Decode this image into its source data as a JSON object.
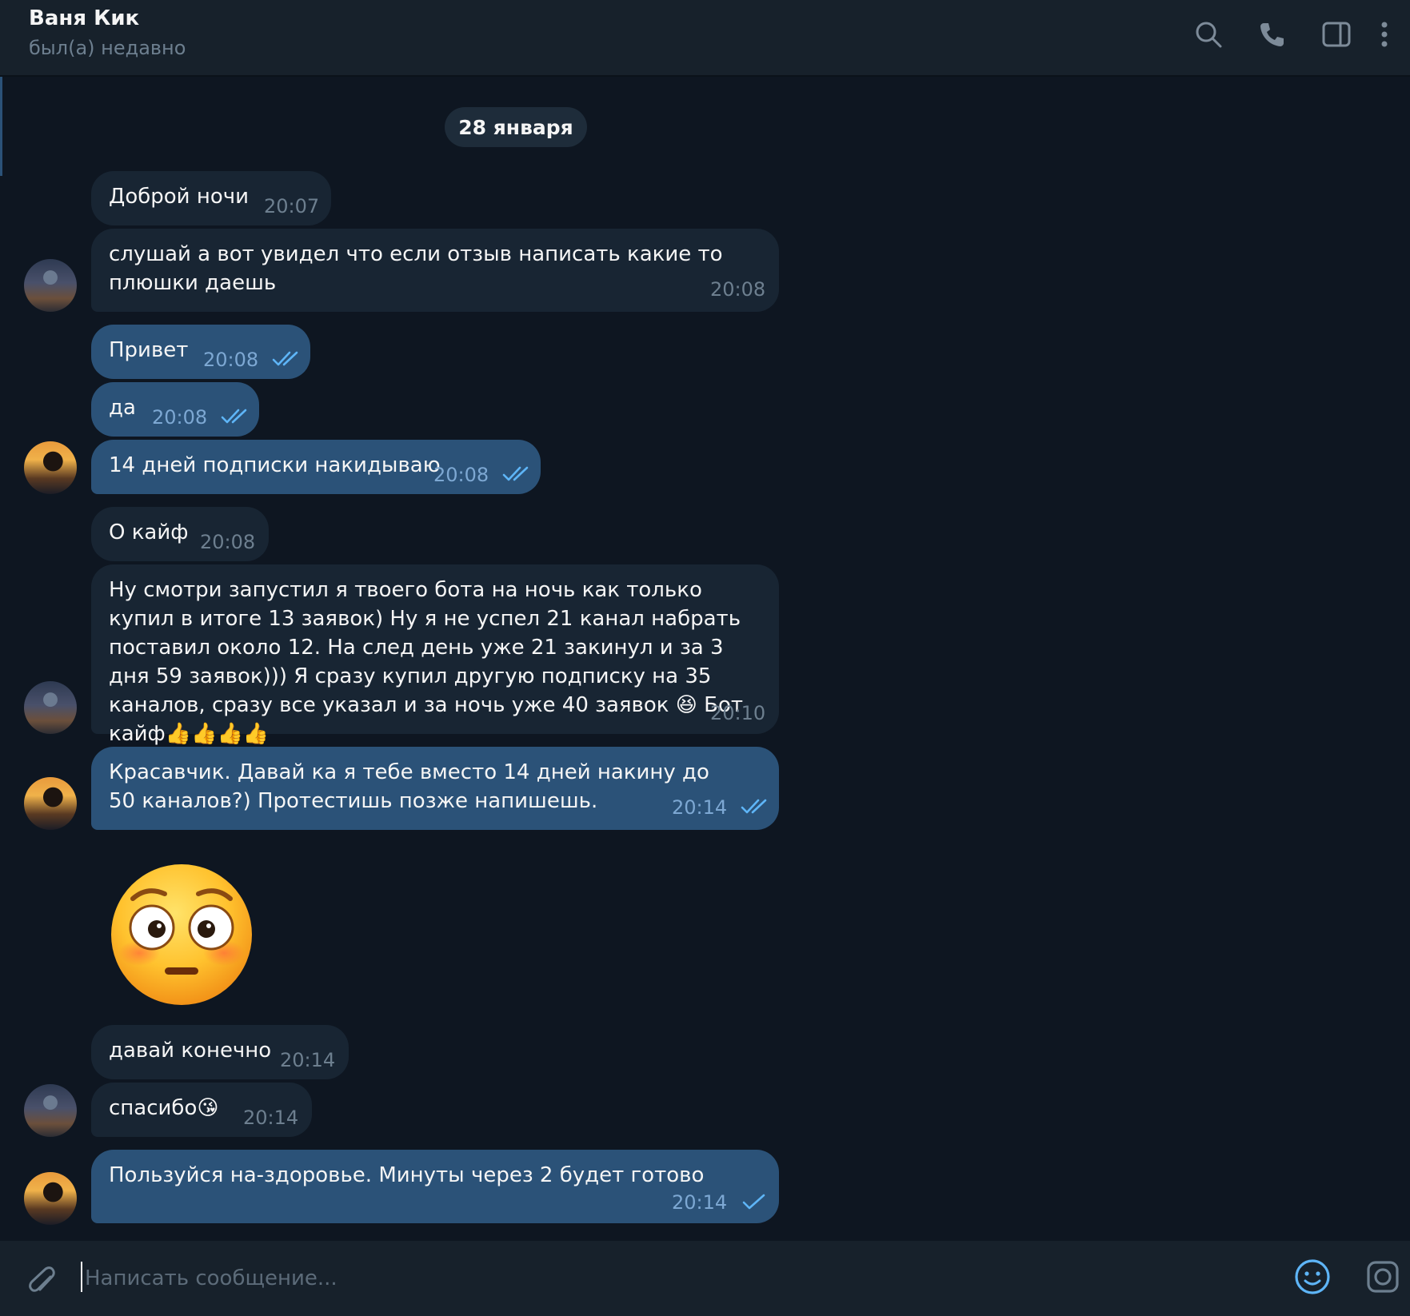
{
  "header": {
    "contact_name": "Ваня Кик",
    "status": "был(а) недавно",
    "icons": [
      "search-icon",
      "phone-icon",
      "sidebar-toggle-icon",
      "more-vertical-icon"
    ]
  },
  "date_separator": "28 января",
  "messages": [
    {
      "direction": "in",
      "text": "Доброй ночи",
      "time": "20:07"
    },
    {
      "direction": "in",
      "text": "слушай а вот увидел что если отзыв написать какие то плюшки даешь",
      "time": "20:08"
    },
    {
      "direction": "out",
      "text": "Привет",
      "time": "20:08",
      "status": "read"
    },
    {
      "direction": "out",
      "text": "да",
      "time": "20:08",
      "status": "read"
    },
    {
      "direction": "out",
      "text": "14 дней подписки накидываю",
      "time": "20:08",
      "status": "read"
    },
    {
      "direction": "in",
      "text": "О кайф",
      "time": "20:08"
    },
    {
      "direction": "in",
      "text": "Ну смотри запустил я твоего бота на ночь как только купил в итоге 13 заявок) Ну я не успел 21 канал набрать поставил около 12. На след день уже 21 закинул и за 3 дня 59 заявок))) Я сразу купил другую подписку на 35 каналов, сразу все указал и за ночь уже 40 заявок 😆 Бот кайф👍👍👍👍",
      "time": "20:10"
    },
    {
      "direction": "out",
      "text": "Красавчик. Давай ка я тебе вместо 14 дней накину до 50 каналов?) Протестишь позже напишешь.",
      "time": "20:14",
      "status": "read"
    },
    {
      "direction": "in",
      "type": "sticker",
      "sticker": "flushed-face"
    },
    {
      "direction": "in",
      "text": "давай конечно",
      "time": "20:14"
    },
    {
      "direction": "in",
      "text": "спасибо😘",
      "time": "20:14"
    },
    {
      "direction": "out",
      "text": "Пользуйся на-здоровье. Минуты через 2 будет готово",
      "time": "20:14",
      "status": "sent"
    }
  ],
  "composer": {
    "placeholder": "Написать сообщение...",
    "icons": [
      "paperclip-icon",
      "emoji-icon",
      "camera-icon"
    ]
  },
  "colors": {
    "background": "#0e1621",
    "panel": "#17212b",
    "incoming_bubble": "#182533",
    "outgoing_bubble": "#2b5278",
    "accent": "#5eb5f7",
    "muted_text": "#6d7f8f"
  }
}
